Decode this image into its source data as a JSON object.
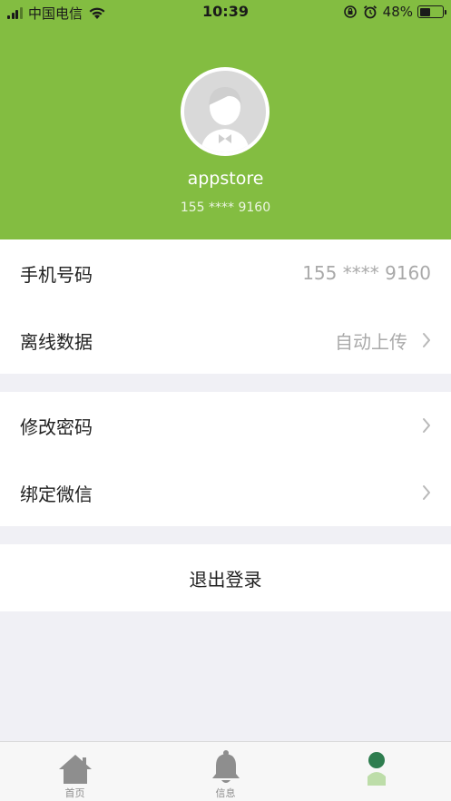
{
  "status_bar": {
    "carrier": "中国电信",
    "time": "10:39",
    "battery_percent": "48%",
    "battery_level": 0.48
  },
  "profile": {
    "username": "appstore",
    "phone_masked": "155 **** 9160"
  },
  "settings": {
    "group1": [
      {
        "label": "手机号码",
        "value": "155 **** 9160"
      },
      {
        "label": "离线数据",
        "value": "自动上传"
      }
    ],
    "group2": [
      {
        "label": "修改密码"
      },
      {
        "label": "绑定微信"
      }
    ],
    "logout_label": "退出登录"
  },
  "tabbar": {
    "items": [
      {
        "label": "首页",
        "icon": "home-icon"
      },
      {
        "label": "信息",
        "icon": "bell-icon"
      },
      {
        "label": "",
        "icon": "profile-icon"
      }
    ]
  },
  "colors": {
    "header_green": "#83bd41",
    "active_tab_green": "#2e7d4f",
    "secondary_text": "#a9a9a9"
  }
}
